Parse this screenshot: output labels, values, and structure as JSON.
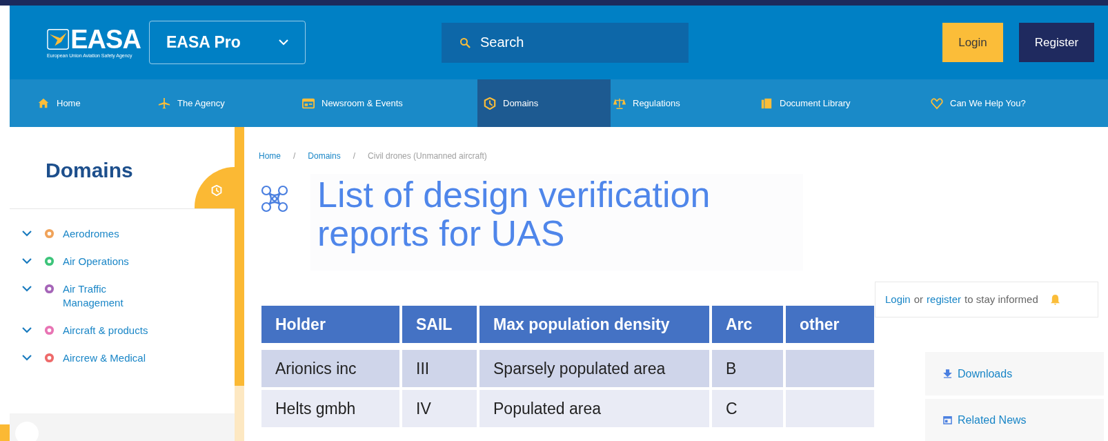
{
  "header": {
    "logo": {
      "wordmark": "EASA",
      "tagline": "European Union Aviation Safety Agency"
    },
    "site_switch": "EASA Pro",
    "search": {
      "placeholder": "Search"
    },
    "buttons": [
      {
        "label": "Login",
        "kind": "primary"
      },
      {
        "label": "Register",
        "kind": "secondary"
      }
    ]
  },
  "nav": [
    {
      "label": "Home",
      "selected": false
    },
    {
      "label": "The Agency",
      "selected": false
    },
    {
      "label": "Newsroom & Events",
      "selected": false
    },
    {
      "label": "Domains",
      "selected": true
    },
    {
      "label": "Regulations",
      "selected": false
    },
    {
      "label": "Document Library",
      "selected": false
    },
    {
      "label": "Can We Help You?",
      "selected": false
    }
  ],
  "sidebar": {
    "title": "Domains",
    "items": [
      {
        "label": "Aerodromes",
        "color": "#f0a35a"
      },
      {
        "label": "Air Operations",
        "color": "#3dc47a"
      },
      {
        "label": "Air Traffic Management",
        "color": "#a565b8"
      },
      {
        "label": "Aircraft & products",
        "color": "#e874b4"
      },
      {
        "label": "Aircrew & Medical",
        "color": "#ee6a6a"
      }
    ]
  },
  "breadcrumb": [
    {
      "kind": "link",
      "text": "Home"
    },
    {
      "kind": "separator",
      "text": "/"
    },
    {
      "kind": "link",
      "text": "Domains"
    },
    {
      "kind": "separator",
      "text": "/"
    },
    {
      "kind": "current",
      "text": "Civil drones (Unmanned aircraft)"
    }
  ],
  "page_title": "List of design verification reports for UAS",
  "table": {
    "columns": [
      "Holder",
      "SAIL",
      "Max population density",
      "Arc",
      "other"
    ],
    "rows": [
      [
        "Arionics inc",
        "III",
        "Sparsely populated area",
        "B",
        ""
      ],
      [
        "Helts gmbh",
        "IV",
        "Populated area",
        "C",
        ""
      ]
    ]
  },
  "subscribe": {
    "login": "Login",
    "or": "or",
    "register": "register",
    "rest": "to stay informed"
  },
  "side_links": [
    {
      "label": "Downloads"
    },
    {
      "label": "Related News"
    }
  ]
}
